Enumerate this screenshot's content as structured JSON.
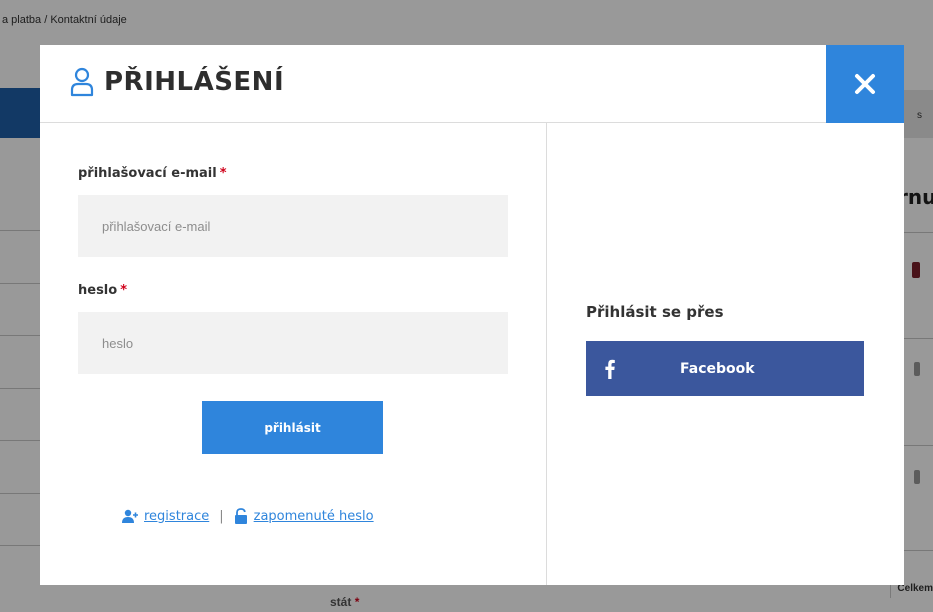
{
  "background": {
    "breadcrumb": "a platba  /  Kontaktní údaje",
    "right_tab_char": "s",
    "heading_fragment": "rnu",
    "country_label": "stát",
    "country_required_mark": "*",
    "total_label": "Celkem"
  },
  "modal": {
    "title": "PŘIHLÁŠENÍ",
    "title_icon": "user-icon",
    "close_icon": "close-icon",
    "email": {
      "label": "přihlašovací e-mail",
      "required_mark": "*",
      "placeholder": "přihlašovací e-mail",
      "value": ""
    },
    "password": {
      "label": "heslo",
      "required_mark": "*",
      "placeholder": "heslo",
      "value": ""
    },
    "submit_label": "přihlásit",
    "register_link": "registrace",
    "register_icon": "add-user-icon",
    "links_separator": "|",
    "forgot_link": "zapomenuté heslo",
    "forgot_icon": "unlock-icon",
    "social_title": "Přihlásit se přes",
    "facebook_label": "Facebook",
    "facebook_icon": "facebook-icon"
  },
  "colors": {
    "accent": "#2f85dc",
    "facebook": "#3b579d",
    "required": "#d0021b",
    "input_bg": "#f2f2f2"
  }
}
